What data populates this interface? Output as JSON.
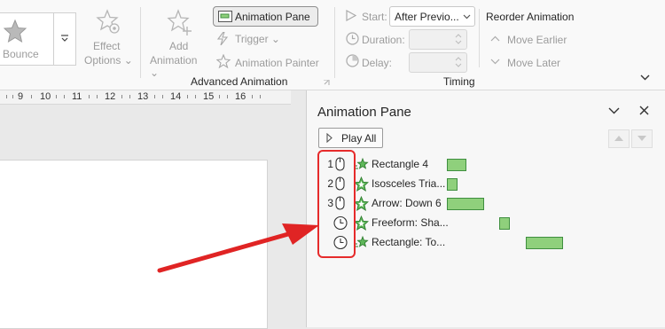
{
  "ribbon": {
    "preview_effect": {
      "label": "Bounce"
    },
    "effect_options": {
      "line1": "Effect",
      "line2": "Options",
      "caret": "⌄"
    },
    "add_animation": {
      "line1": "Add",
      "line2": "Animation",
      "caret": "⌄"
    },
    "animation_pane_btn": "Animation Pane",
    "trigger": {
      "label": "Trigger",
      "caret": "⌄"
    },
    "animation_painter": "Animation Painter",
    "group_advanced": "Advanced Animation",
    "start": {
      "label": "Start:",
      "value": "After Previo..."
    },
    "duration_label": "Duration:",
    "delay_label": "Delay:",
    "group_timing": "Timing",
    "reorder_title": "Reorder Animation",
    "move_earlier": "Move Earlier",
    "move_later": "Move Later"
  },
  "ruler": {
    "labels": [
      "9",
      "10",
      "11",
      "12",
      "13",
      "14",
      "15",
      "16"
    ]
  },
  "pane": {
    "title": "Animation Pane",
    "play_all": "Play All",
    "items": [
      {
        "num": "1",
        "trigger": "mouse-click-icon",
        "effect": "small-star-icon",
        "name": "Rectangle 4",
        "bar_start": 0,
        "bar_length": 0.3
      },
      {
        "num": "2",
        "trigger": "mouse-click-icon",
        "effect": "large-star-icon",
        "name": "Isosceles Tria...",
        "bar_start": 0,
        "bar_length": 0.15
      },
      {
        "num": "3",
        "trigger": "mouse-click-icon",
        "effect": "large-star-icon",
        "name": "Arrow: Down 6",
        "bar_start": 0,
        "bar_length": 0.6
      },
      {
        "num": "",
        "trigger": "clock-icon",
        "effect": "large-star-icon",
        "name": "Freeform: Sha...",
        "bar_start": 0.9,
        "bar_length": 0.15
      },
      {
        "num": "",
        "trigger": "clock-icon",
        "effect": "small-star-icon",
        "name": "Rectangle: To...",
        "bar_start": 1.35,
        "bar_length": 0.6
      }
    ]
  },
  "colors": {
    "accent_green": "#8fd07c",
    "highlight_red": "#e62b2b"
  }
}
